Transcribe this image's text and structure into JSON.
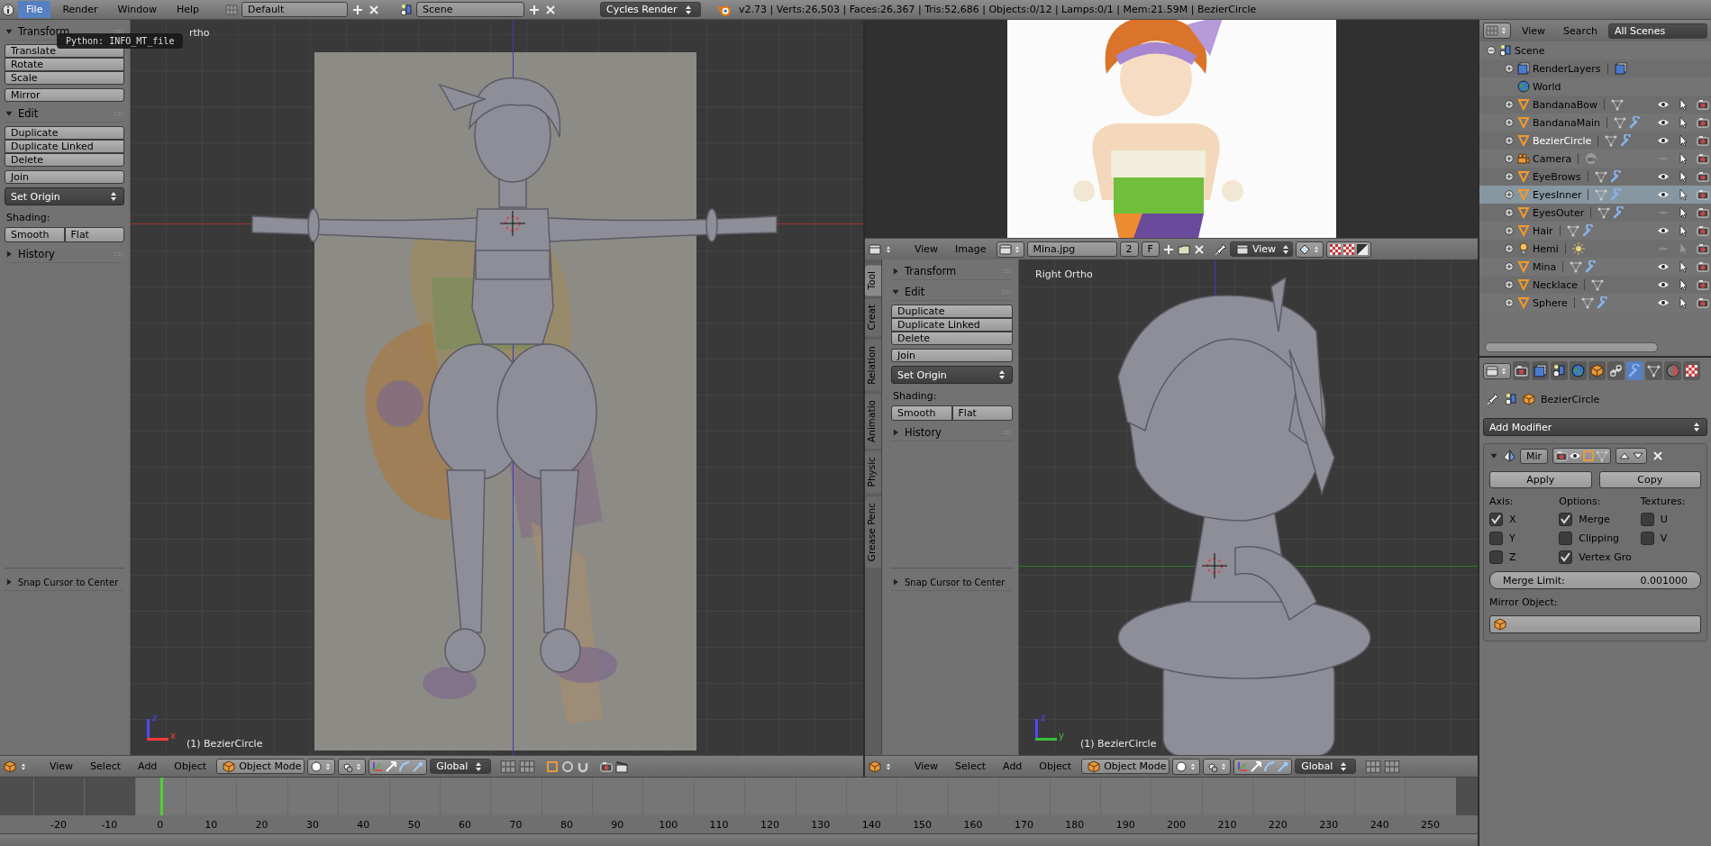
{
  "top_bar": {
    "menus": [
      {
        "label": "File",
        "selected": true
      },
      {
        "label": "Render",
        "selected": false
      },
      {
        "label": "Window",
        "selected": false
      },
      {
        "label": "Help",
        "selected": false
      }
    ],
    "layout": "Default",
    "scene": "Scene",
    "engine": "Cycles Render",
    "stats": "v2.73 | Verts:26,503 | Faces:26,367 | Tris:52,686 | Objects:0/12 | Lamps:0/1 | Mem:21.59M | BezierCircle"
  },
  "tooltip": "Python: INFO_MT_file",
  "left_view": {
    "view_label": "rtho",
    "object_label": "(1) BezierCircle",
    "axes": [
      {
        "label": "z",
        "color": "#4a4aff"
      },
      {
        "label": "x",
        "color": "#ff3a3a"
      }
    ],
    "shelf": [
      {
        "kind": "panel",
        "label": "Transform",
        "expanded": true
      },
      {
        "kind": "buttons",
        "labels": [
          "Translate",
          "Rotate",
          "Scale"
        ]
      },
      {
        "kind": "buttons",
        "labels": [
          "Mirror"
        ]
      },
      {
        "kind": "panel",
        "label": "Edit",
        "expanded": true
      },
      {
        "kind": "buttons",
        "labels": [
          "Duplicate",
          "Duplicate Linked",
          "Delete"
        ]
      },
      {
        "kind": "buttons",
        "labels": [
          "Join"
        ]
      },
      {
        "kind": "dropdown",
        "label": "Set Origin"
      },
      {
        "kind": "label",
        "label": "Shading:"
      },
      {
        "kind": "row",
        "labels": [
          "Smooth",
          "Flat"
        ]
      },
      {
        "kind": "panel",
        "label": "History",
        "expanded": false
      }
    ],
    "operator": "Snap Cursor to Center",
    "header": {
      "menus": [
        "View",
        "Select",
        "Add",
        "Object"
      ],
      "mode": "Object Mode",
      "orientation": "Global"
    }
  },
  "image_editor": {
    "menus": [
      "View",
      "Image"
    ],
    "image": "Mina.jpg",
    "users": "2",
    "fake": "F",
    "view": "View"
  },
  "right_view": {
    "view_label": "Right Ortho",
    "object_label": "(1) BezierCircle",
    "axes": [
      {
        "label": "z",
        "color": "#4a4aff"
      },
      {
        "label": "y",
        "color": "#3ac03a"
      }
    ],
    "tabs": [
      {
        "label": "Tool",
        "selected": true
      },
      {
        "label": "Creat",
        "selected": false
      },
      {
        "label": "Relation",
        "selected": false
      },
      {
        "label": "Animatio",
        "selected": false
      },
      {
        "label": "Physic",
        "selected": false
      },
      {
        "label": "Grease Penc",
        "selected": false
      }
    ],
    "shelf": [
      {
        "kind": "panel",
        "label": "Transform",
        "expanded": false
      },
      {
        "kind": "panel",
        "label": "Edit",
        "expanded": true
      },
      {
        "kind": "buttons",
        "labels": [
          "Duplicate",
          "Duplicate Linked",
          "Delete"
        ]
      },
      {
        "kind": "buttons",
        "labels": [
          "Join"
        ]
      },
      {
        "kind": "dropdown",
        "label": "Set Origin"
      },
      {
        "kind": "label",
        "label": "Shading:"
      },
      {
        "kind": "row",
        "labels": [
          "Smooth",
          "Flat"
        ]
      },
      {
        "kind": "panel",
        "label": "History",
        "expanded": false
      }
    ],
    "operator": "Snap Cursor to Center",
    "header": {
      "menus": [
        "View",
        "Select",
        "Add",
        "Object"
      ],
      "mode": "Object Mode",
      "orientation": "Global"
    }
  },
  "timeline": {
    "ticks": [
      {
        "label": "-20",
        "in_range": false,
        "current": false
      },
      {
        "label": "-10",
        "in_range": false,
        "current": false
      },
      {
        "label": "0",
        "in_range": true,
        "current": true
      },
      {
        "label": "10",
        "in_range": true,
        "current": false
      },
      {
        "label": "20",
        "in_range": true,
        "current": false
      },
      {
        "label": "30",
        "in_range": true,
        "current": false
      },
      {
        "label": "40",
        "in_range": true,
        "current": false
      },
      {
        "label": "50",
        "in_range": true,
        "current": false
      },
      {
        "label": "60",
        "in_range": true,
        "current": false
      },
      {
        "label": "70",
        "in_range": true,
        "current": false
      },
      {
        "label": "80",
        "in_range": true,
        "current": false
      },
      {
        "label": "90",
        "in_range": true,
        "current": false
      },
      {
        "label": "100",
        "in_range": true,
        "current": false
      },
      {
        "label": "110",
        "in_range": true,
        "current": false
      },
      {
        "label": "120",
        "in_range": true,
        "current": false
      },
      {
        "label": "130",
        "in_range": true,
        "current": false
      },
      {
        "label": "140",
        "in_range": true,
        "current": false
      },
      {
        "label": "150",
        "in_range": true,
        "current": false
      },
      {
        "label": "160",
        "in_range": true,
        "current": false
      },
      {
        "label": "170",
        "in_range": true,
        "current": false
      },
      {
        "label": "180",
        "in_range": true,
        "current": false
      },
      {
        "label": "190",
        "in_range": true,
        "current": false
      },
      {
        "label": "200",
        "in_range": true,
        "current": false
      },
      {
        "label": "210",
        "in_range": true,
        "current": false
      },
      {
        "label": "220",
        "in_range": true,
        "current": false
      },
      {
        "label": "230",
        "in_range": true,
        "current": false
      },
      {
        "label": "240",
        "in_range": true,
        "current": false
      },
      {
        "label": "250",
        "in_range": true,
        "current": false
      }
    ]
  },
  "outliner": {
    "menus": [
      "View",
      "Search"
    ],
    "filter": "All Scenes",
    "tree": [
      {
        "name": "Scene",
        "kind": "scene",
        "expanded": true,
        "selected": false,
        "children": [
          {
            "name": "RenderLayers",
            "kind": "renderlayers",
            "expanded": false,
            "selected": false
          },
          {
            "name": "World",
            "kind": "world",
            "selected": false
          },
          {
            "name": "BandanaBow",
            "kind": "mesh",
            "expanded": false,
            "selected": false,
            "active": false,
            "modifier": false,
            "visible": true,
            "selectable": true
          },
          {
            "name": "BandanaMain",
            "kind": "mesh",
            "expanded": false,
            "selected": false,
            "active": false,
            "modifier": true,
            "visible": true,
            "selectable": true
          },
          {
            "name": "BezierCircle",
            "kind": "mesh",
            "expanded": false,
            "selected": false,
            "active": true,
            "modifier": true,
            "visible": true,
            "selectable": true
          },
          {
            "name": "Camera",
            "kind": "camera",
            "expanded": false,
            "selected": false,
            "active": false,
            "modifier": false,
            "visible": false,
            "selectable": true
          },
          {
            "name": "EyeBrows",
            "kind": "mesh",
            "expanded": false,
            "selected": false,
            "active": false,
            "modifier": true,
            "visible": true,
            "selectable": true
          },
          {
            "name": "EyesInner",
            "kind": "mesh",
            "expanded": false,
            "selected": true,
            "active": false,
            "modifier": true,
            "visible": true,
            "selectable": true
          },
          {
            "name": "EyesOuter",
            "kind": "mesh",
            "expanded": false,
            "selected": false,
            "active": false,
            "modifier": true,
            "visible": false,
            "selectable": true
          },
          {
            "name": "Hair",
            "kind": "mesh",
            "expanded": false,
            "selected": false,
            "active": false,
            "modifier": true,
            "visible": true,
            "selectable": true
          },
          {
            "name": "Hemi",
            "kind": "lamp",
            "expanded": false,
            "selected": false,
            "active": false,
            "modifier": false,
            "visible": false,
            "selectable": false
          },
          {
            "name": "Mina",
            "kind": "mesh",
            "expanded": false,
            "selected": false,
            "active": false,
            "modifier": true,
            "visible": true,
            "selectable": true
          },
          {
            "name": "Necklace",
            "kind": "mesh",
            "expanded": false,
            "selected": false,
            "active": false,
            "modifier": false,
            "visible": true,
            "selectable": true
          },
          {
            "name": "Sphere",
            "kind": "mesh",
            "expanded": false,
            "selected": false,
            "active": false,
            "modifier": true,
            "visible": true,
            "selectable": true
          }
        ]
      }
    ]
  },
  "properties": {
    "tabs": [
      {
        "kind": "render",
        "selected": false
      },
      {
        "kind": "renderlayers",
        "selected": false
      },
      {
        "kind": "scene",
        "selected": false
      },
      {
        "kind": "world",
        "selected": false
      },
      {
        "kind": "object",
        "selected": false
      },
      {
        "kind": "constraints",
        "selected": false
      },
      {
        "kind": "modifiers",
        "selected": true
      },
      {
        "kind": "data",
        "selected": false
      },
      {
        "kind": "material",
        "selected": false
      },
      {
        "kind": "texture",
        "selected": false
      }
    ],
    "context": "BezierCircle",
    "add_modifier": "Add Modifier",
    "modifier": {
      "name": "Mir",
      "expanded": true,
      "apply": "Apply",
      "copy": "Copy",
      "columns": [
        {
          "heading": "Axis:",
          "options": [
            {
              "label": "X",
              "checked": true
            },
            {
              "label": "Y",
              "checked": false
            },
            {
              "label": "Z",
              "checked": false
            }
          ]
        },
        {
          "heading": "Options:",
          "options": [
            {
              "label": "Merge",
              "checked": true
            },
            {
              "label": "Clipping",
              "checked": false
            },
            {
              "label": "Vertex Gro",
              "checked": true
            }
          ]
        },
        {
          "heading": "Textures:",
          "options": [
            {
              "label": "U",
              "checked": false
            },
            {
              "label": "V",
              "checked": false
            }
          ]
        }
      ],
      "merge_limit_label": "Merge Limit:",
      "merge_limit": "0.001000",
      "mirror_object_label": "Mirror Object:"
    }
  }
}
